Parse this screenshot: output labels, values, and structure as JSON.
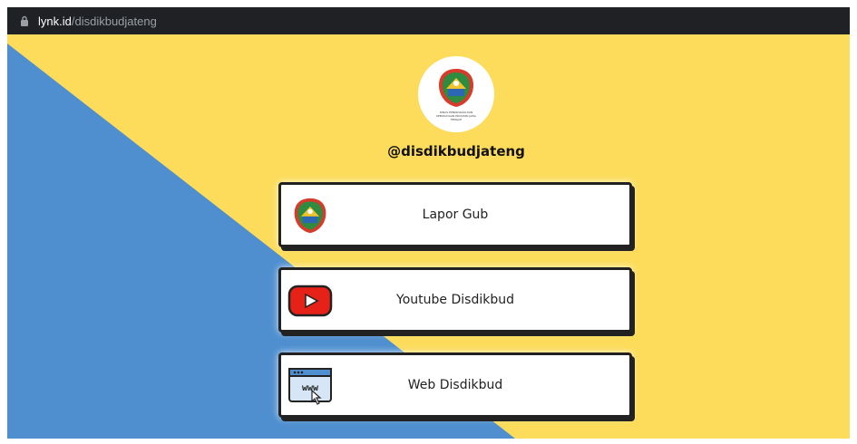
{
  "browser": {
    "url_domain": "lynk.id",
    "url_path": "/disdikbudjateng"
  },
  "profile": {
    "username": "@disdikbudjateng",
    "logo_caption": "DINAS PENDIDIKAN DAN KEBUDAYAAN PROVINSI JAWA TENGAH"
  },
  "links": [
    {
      "label": "Lapor Gub",
      "icon": "jateng-emblem-icon"
    },
    {
      "label": "Youtube Disdikbud",
      "icon": "youtube-icon"
    },
    {
      "label": "Web Disdikbud",
      "icon": "www-browser-icon"
    }
  ],
  "colors": {
    "background_yellow": "#fcdc5a",
    "background_blue": "#4f8fcf",
    "card_border": "#222222",
    "youtube_red": "#e62117"
  }
}
